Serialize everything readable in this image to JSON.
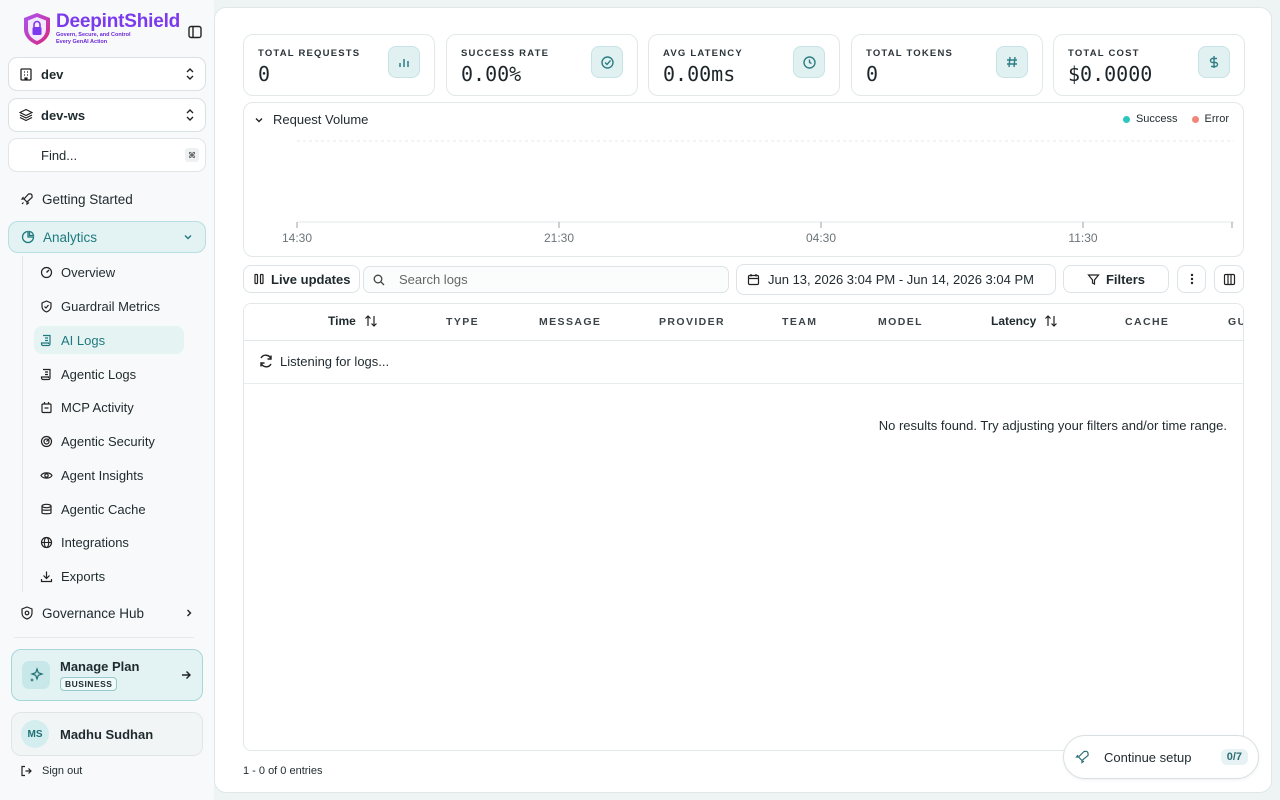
{
  "brand": {
    "name": "DeepintShield",
    "tagline_1": "Govern, Secure, and Control",
    "tagline_2": "Every GenAI Action"
  },
  "selectors": {
    "environment": "dev",
    "workspace": "dev-ws"
  },
  "find": {
    "label": "Find...",
    "shortcut": "⌘"
  },
  "nav": {
    "getting_started": "Getting Started",
    "analytics": "Analytics",
    "governance_hub": "Governance Hub",
    "sub_items": [
      {
        "label": "Overview"
      },
      {
        "label": "Guardrail Metrics"
      },
      {
        "label": "AI Logs"
      },
      {
        "label": "Agentic Logs"
      },
      {
        "label": "MCP Activity"
      },
      {
        "label": "Agentic Security"
      },
      {
        "label": "Agent Insights"
      },
      {
        "label": "Agentic Cache"
      },
      {
        "label": "Integrations"
      },
      {
        "label": "Exports"
      }
    ]
  },
  "plan": {
    "title": "Manage Plan",
    "badge": "BUSINESS"
  },
  "user": {
    "initials": "MS",
    "name": "Madhu Sudhan"
  },
  "sign_out": "Sign out",
  "stats": [
    {
      "label": "TOTAL REQUESTS",
      "value": "0",
      "icon": "bar-chart-icon"
    },
    {
      "label": "SUCCESS RATE",
      "value": "0.00%",
      "icon": "check-circle-icon"
    },
    {
      "label": "AVG LATENCY",
      "value": "0.00ms",
      "icon": "clock-icon"
    },
    {
      "label": "TOTAL TOKENS",
      "value": "0",
      "icon": "hash-icon"
    },
    {
      "label": "TOTAL COST",
      "value": "$0.0000",
      "icon": "dollar-icon"
    }
  ],
  "request_chart": {
    "title": "Request Volume",
    "legend": {
      "success": "Success",
      "error": "Error"
    },
    "colors": {
      "success": "#2dc6bf",
      "error": "#f2857a"
    }
  },
  "chart_data": {
    "type": "bar",
    "title": "Request Volume",
    "categories": [
      "14:30",
      "21:30",
      "04:30",
      "11:30"
    ],
    "series": [
      {
        "name": "Success",
        "values": [
          0,
          0,
          0,
          0
        ]
      },
      {
        "name": "Error",
        "values": [
          0,
          0,
          0,
          0
        ]
      }
    ],
    "xlabel": "",
    "ylabel": "",
    "grid": true,
    "legend_position": "top-right"
  },
  "toolbar": {
    "live_updates": "Live updates",
    "search_placeholder": "Search logs",
    "date_range": "Jun 13, 2026 3:04 PM - Jun 14, 2026 3:04 PM",
    "filters": "Filters"
  },
  "table": {
    "columns": [
      "Time",
      "TYPE",
      "MESSAGE",
      "PROVIDER",
      "TEAM",
      "MODEL",
      "Latency",
      "CACHE",
      "GU"
    ],
    "listening": "Listening for logs...",
    "empty": "No results found. Try adjusting your filters and/or time range."
  },
  "entries": "1 - 0 of 0 entries",
  "setup": {
    "label": "Continue setup",
    "progress": "0/7"
  }
}
